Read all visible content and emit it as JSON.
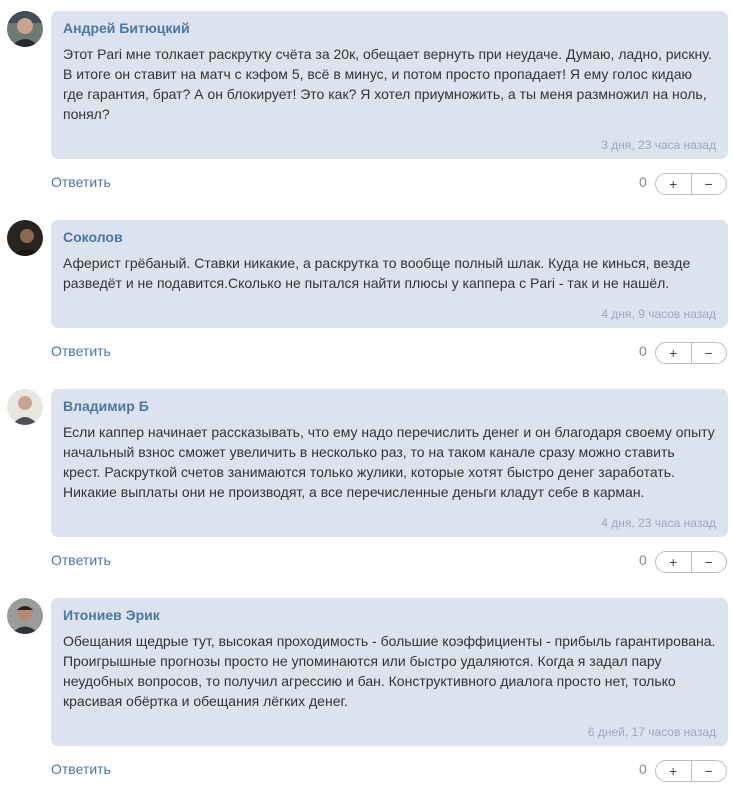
{
  "reply_label": "Ответить",
  "plus_label": "+",
  "minus_label": "−",
  "comments": [
    {
      "author": "Андрей Битюцкий",
      "text": "Этот Pari мне толкает раскрутку счёта за 20к, обещает вернуть при неудаче. Думаю, ладно, рискну. В итоге он ставит на матч с кэфом 5, всё в минус, и потом просто пропадает! Я ему голос кидаю где гарантия, брат? А он блокирует! Это как? Я хотел приумножить, а ты меня размножил на ноль, понял?",
      "time": "3 дня, 23 часа назад",
      "votes": "0"
    },
    {
      "author": "Соколов",
      "text": "Аферист грёбаный. Ставки никакие, а раскрутка то вообще полный шлак. Куда не кинься, везде разведёт и не подавится.Сколько не пытался найти плюсы у каппера с Pari - так и не нашёл.",
      "time": "4 дня, 9 часов назад",
      "votes": "0"
    },
    {
      "author": "Владимир Б",
      "text": "Если каппер начинает рассказывать, что ему надо перечислить денег и он благодаря своему опыту начальный взнос сможет увеличить в несколько раз, то на таком канале сразу можно ставить крест. Раскруткой счетов занимаются только жулики, которые хотят быстро денег заработать. Никакие выплаты они не производят, а все перечисленные деньги кладут себе в карман.",
      "time": "4 дня, 23 часа назад",
      "votes": "0"
    },
    {
      "author": "Итониев Эрик",
      "text": "Обещания щедрые тут, высокая проходимость - большие коэффициенты - прибыль гарантирована. Проигрышные прогнозы просто не упоминаются или быстро удаляются. Когда я задал пару неудобных вопросов, то получил агрессию и бан. Конструктивного диалога просто нет, только красивая обёртка и обещания лёгких денег.",
      "time": "6 дней, 17 часов назад",
      "votes": "0"
    }
  ]
}
